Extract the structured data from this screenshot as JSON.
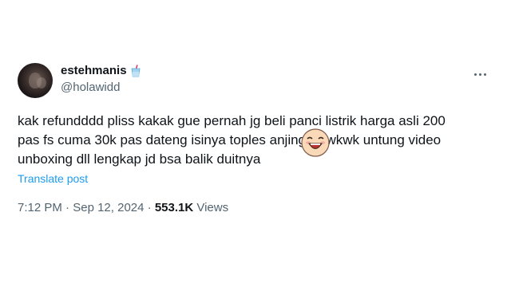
{
  "author": {
    "display_name": "estehmanis",
    "handle": "@holawidd",
    "badge_icon": "cup-with-straw-icon"
  },
  "tweet": {
    "text_line_1": "kak refundddd pliss kakak gue pernah jg beli panci listrik harga asli 200",
    "text_line_2": "pas fs cuma 30k pas dateng isinya toples anjing wkwkwk untung video",
    "text_line_3": "unboxing dll lengkap jd bsa balik duitnya",
    "emoji_icon": "laughing-face-emoji-icon",
    "translate_label": "Translate post"
  },
  "meta": {
    "time": "7:12 PM",
    "separator_1": "·",
    "date": "Sep 12, 2024",
    "separator_2": "·",
    "views_count": "553.1K",
    "views_label": "Views"
  },
  "colors": {
    "link": "#1d9bf0",
    "secondary_text": "#536471",
    "primary_text": "#0f1419"
  }
}
